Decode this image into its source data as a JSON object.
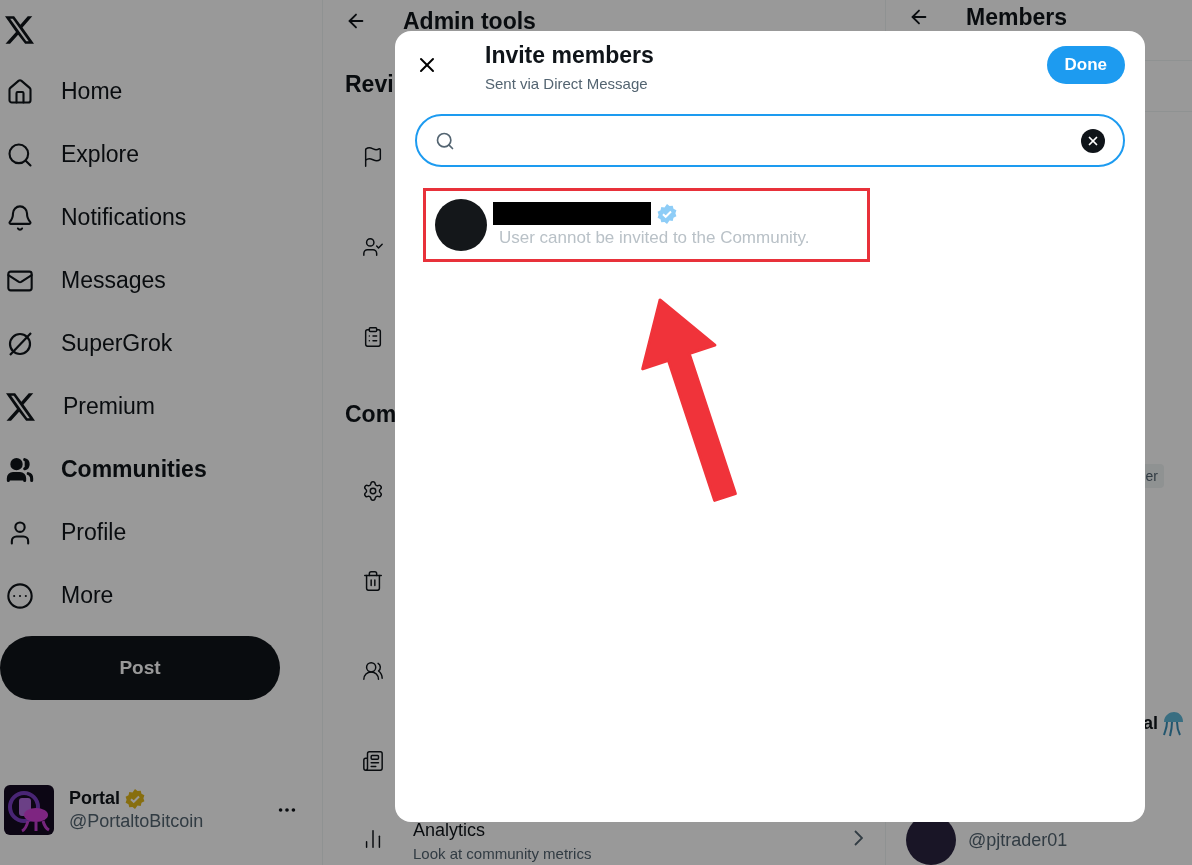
{
  "sidebar": {
    "items": [
      {
        "label": "Home",
        "selected": false
      },
      {
        "label": "Explore",
        "selected": false
      },
      {
        "label": "Notifications",
        "selected": false
      },
      {
        "label": "Messages",
        "selected": false
      },
      {
        "label": "SuperGrok",
        "selected": false
      },
      {
        "label": "Premium",
        "selected": false
      },
      {
        "label": "Communities",
        "selected": true
      },
      {
        "label": "Profile",
        "selected": false
      },
      {
        "label": "More",
        "selected": false
      }
    ]
  },
  "post_button": "Post",
  "account": {
    "name": "Portal",
    "handle": "@PortaltoBitcoin",
    "verified": true
  },
  "admin_tools": {
    "title": "Admin tools",
    "review_heading": "Revi",
    "community_heading": "Com",
    "analytics": {
      "title": "Analytics",
      "description": "Look at community metrics"
    }
  },
  "members_panel": {
    "title": "Members",
    "chip": "er",
    "name": "al",
    "handle": "@pjtrader01"
  },
  "invite_dialog": {
    "title": "Invite members",
    "subtitle": "Sent via Direct Message",
    "done_button": "Done",
    "results": [
      {
        "name_redacted": true,
        "verified": true,
        "disabled": true,
        "highlighted": true,
        "message": "User cannot be invited to the Community."
      }
    ]
  }
}
